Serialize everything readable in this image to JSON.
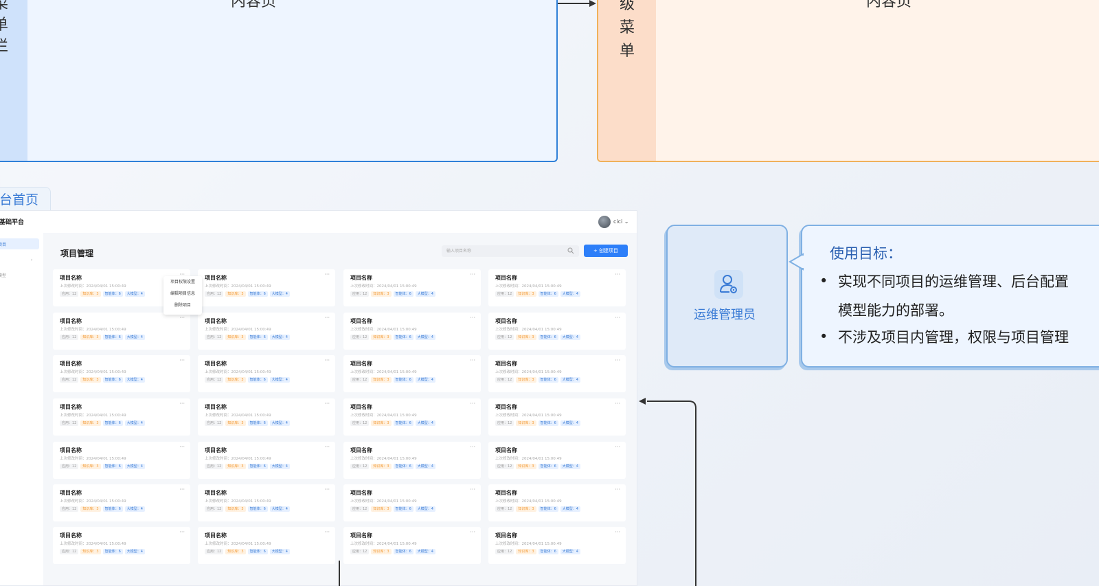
{
  "top_diagram": {
    "left_sidebar_chars": [
      "菜",
      "单",
      "栏"
    ],
    "left_content_label": "内容页",
    "right_sidebar_chars": [
      "级",
      "菜",
      "单"
    ],
    "right_content_label": "内容页"
  },
  "section_tab": "台首页",
  "app": {
    "brand": "基础平台",
    "user": "cici ⌄",
    "page_title": "项目管理",
    "search_placeholder": "输入项目名称",
    "create_button": "+ 创建项目",
    "sidebar_items": [
      "项目",
      "› ",
      "模型"
    ],
    "context_menu": [
      "项目权限设置",
      "编辑项目信息",
      "删除项目"
    ],
    "card": {
      "title": "项目名称",
      "time": "上次修改时间：2024/04/01 15:00:49",
      "tags": [
        "应用：12",
        "知识库：3",
        "智能体：6",
        "大模型：4"
      ],
      "more": "···"
    }
  },
  "role": {
    "icon": "user-gear-icon",
    "label": "运维管理员"
  },
  "goal": {
    "title": "使用目标：",
    "line1": "实现不同项目的运维管理、后台配置",
    "line1b": "模型能力的部署。",
    "line2": "不涉及项目内管理，权限与项目管理"
  },
  "colors": {
    "accent_blue": "#2f80d8",
    "accent_orange": "#f0b15a",
    "primary_button": "#2d7ff9"
  }
}
